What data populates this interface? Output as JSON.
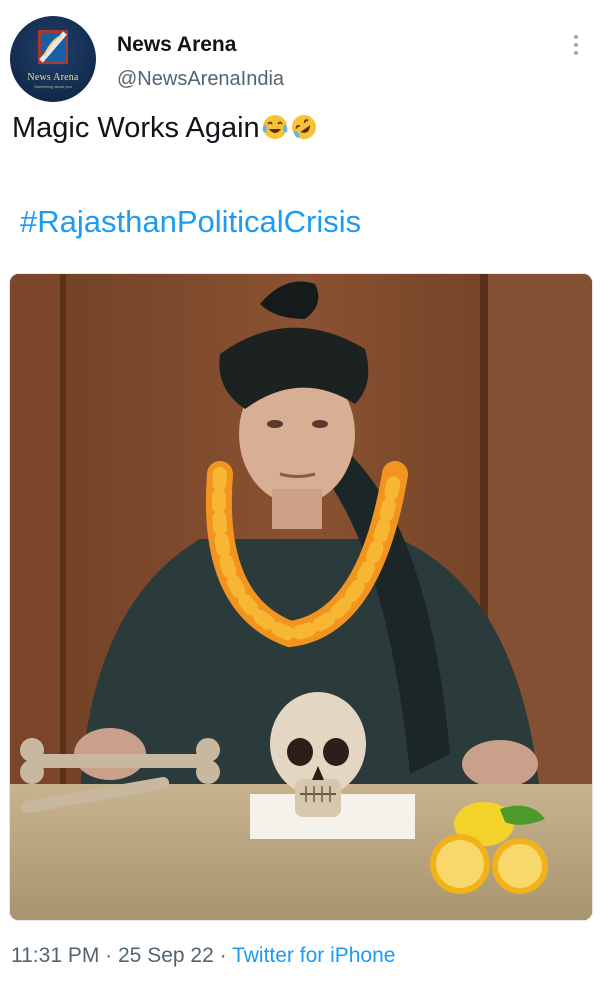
{
  "author": {
    "display_name": "News Arena",
    "handle": "@NewsArenaIndia",
    "avatar_text": "News Arena",
    "avatar_subtext": "Something about you"
  },
  "tweet": {
    "text": "Magic Works Again",
    "emojis": [
      "face-with-tears-of-joy-icon",
      "rolling-on-floor-laughing-icon"
    ],
    "hashtag": "#RajasthanPoliticalCrisis"
  },
  "meta": {
    "time": "11:31 PM",
    "separator": " · ",
    "date": "25 Sep 22",
    "source": "Twitter for iPhone"
  },
  "colors": {
    "link": "#1d9bf0",
    "muted": "#536471",
    "text": "#0f1419"
  },
  "media": {
    "icons": [
      "turban-icon",
      "marigold-garland-icon",
      "skull-icon",
      "bones-icon",
      "lemon-icon",
      "wood-panel-background"
    ]
  }
}
